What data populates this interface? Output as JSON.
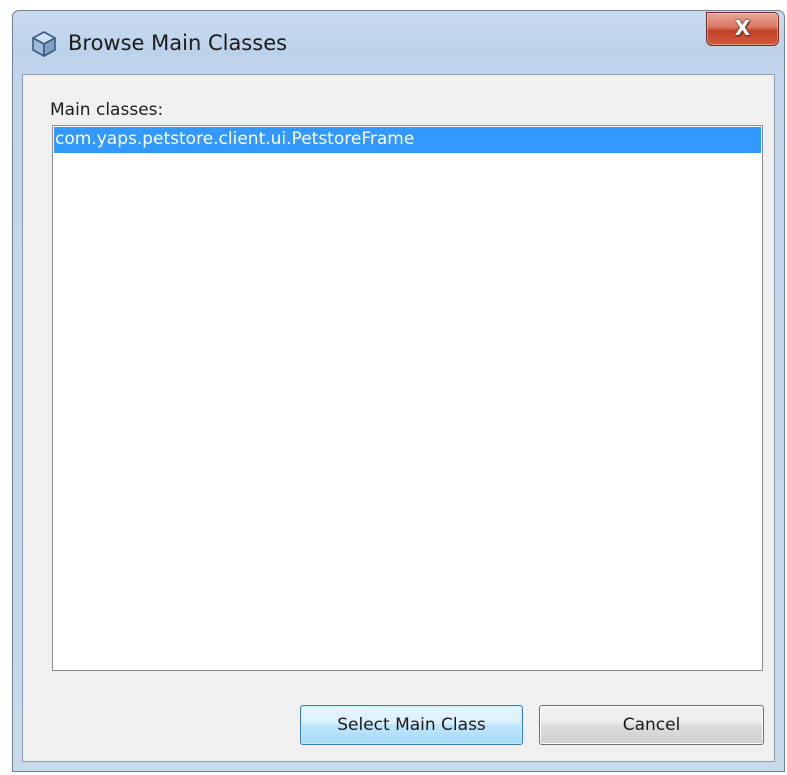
{
  "window": {
    "title": "Browse Main Classes",
    "close_label": "X"
  },
  "main": {
    "label": "Main classes:",
    "classes": [
      {
        "name": "com.yaps.petstore.client.ui.PetstoreFrame",
        "selected": true
      }
    ]
  },
  "buttons": {
    "select_label": "Select Main Class",
    "cancel_label": "Cancel"
  },
  "colors": {
    "selection": "#3399ff",
    "close_button": "#c2412a"
  },
  "icons": {
    "title": "netbeans-cube-icon",
    "close": "close-icon"
  }
}
